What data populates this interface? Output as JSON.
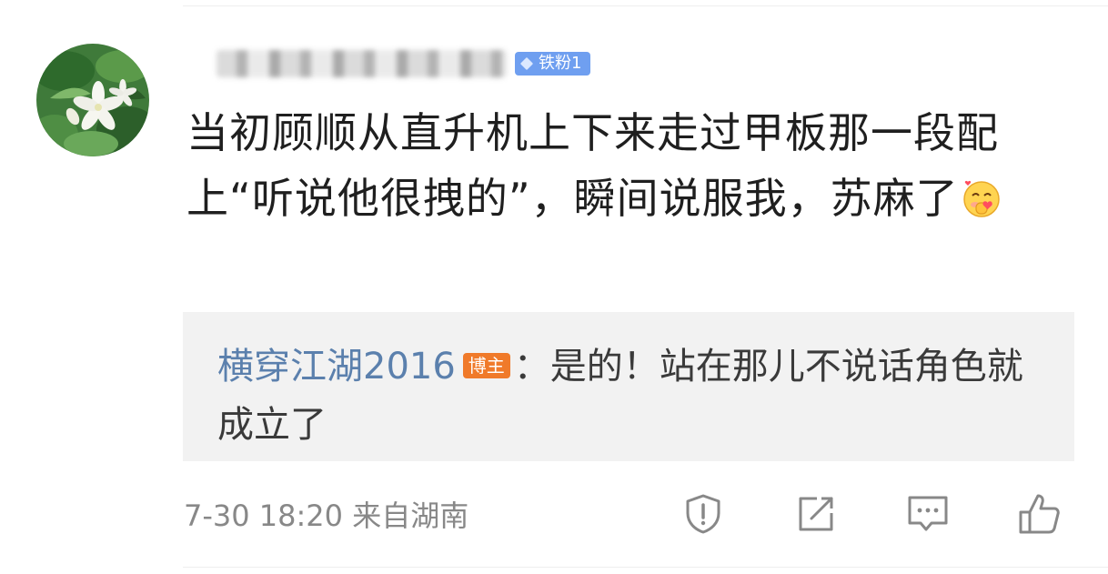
{
  "comment": {
    "author_badge": "铁粉1",
    "avatar_icon": "jasmine-flower-photo",
    "text": "当初顾顺从直升机上下来走过甲板那一段配上“听说他很拽的”，瞬间说服我，苏麻了",
    "emoji_icon": "shy-face-emoji"
  },
  "reply": {
    "author": "横穿江湖2016",
    "author_badge": "博主",
    "separator": "：",
    "text": "是的！站在那儿不说话角色就成立了",
    "author_color": "#5b80ad",
    "badge_color": "#f07a2a"
  },
  "footer": {
    "timestamp": "7-30 18:20 来自湖南",
    "actions": [
      {
        "icon": "report-icon"
      },
      {
        "icon": "share-icon"
      },
      {
        "icon": "comment-icon"
      },
      {
        "icon": "like-icon"
      }
    ]
  },
  "colors": {
    "fan_badge": "#6f9ff0",
    "reply_background": "#f2f2f2",
    "meta_text": "#888888"
  }
}
